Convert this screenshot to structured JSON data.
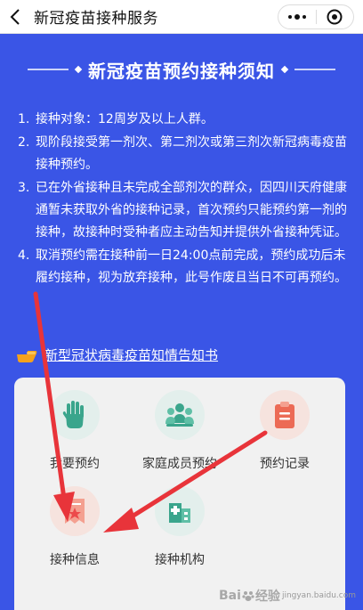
{
  "header": {
    "title": "新冠疫苗接种服务",
    "back_icon": "chevron-left-icon",
    "more_icon": "more-dots-icon",
    "close_icon": "target-close-icon"
  },
  "notice": {
    "title": "新冠疫苗预约接种须知",
    "items": [
      {
        "num": "1.",
        "text": "接种对象：12周岁及以上人群。"
      },
      {
        "num": "2.",
        "text": "现阶段接受第一剂次、第二剂次或第三剂次新冠病毒疫苗接种预约。"
      },
      {
        "num": "3.",
        "text": "已在外省接种且未完成全部剂次的群众，因四川天府健康通暂未获取外省的接种记录，首次预约只能预约第一剂的接种，故接种时受种者应主动告知并提供外省接种凭证。"
      },
      {
        "num": "4.",
        "text": "取消预约需在接种前一日24:00点前完成，预约成功后未履约接种，视为放弃接种，此号作废且当日不可再预约。"
      }
    ]
  },
  "consent": {
    "label": "新型冠状病毒疫苗知情告知书",
    "icon": "pointing-hand-icon"
  },
  "menu": [
    {
      "label": "我要预约",
      "icon": "hand-icon",
      "bg": "#e3efec"
    },
    {
      "label": "家庭成员预约",
      "icon": "family-icon",
      "bg": "#e3efec"
    },
    {
      "label": "预约记录",
      "icon": "clipboard-icon",
      "bg": "#f6e3de"
    },
    {
      "label": "接种信息",
      "icon": "certificate-icon",
      "bg": "#f6e3de"
    },
    {
      "label": "接种机构",
      "icon": "hospital-icon",
      "bg": "#e3efec"
    }
  ],
  "watermark": {
    "brand": "Bai",
    "suffix": "经验",
    "sub": "jingyan.baidu.com"
  },
  "colors": {
    "background": "#3a55e6",
    "arrow": "#e8343a",
    "accent_green": "#3aa58c",
    "accent_red": "#ec6a55"
  }
}
